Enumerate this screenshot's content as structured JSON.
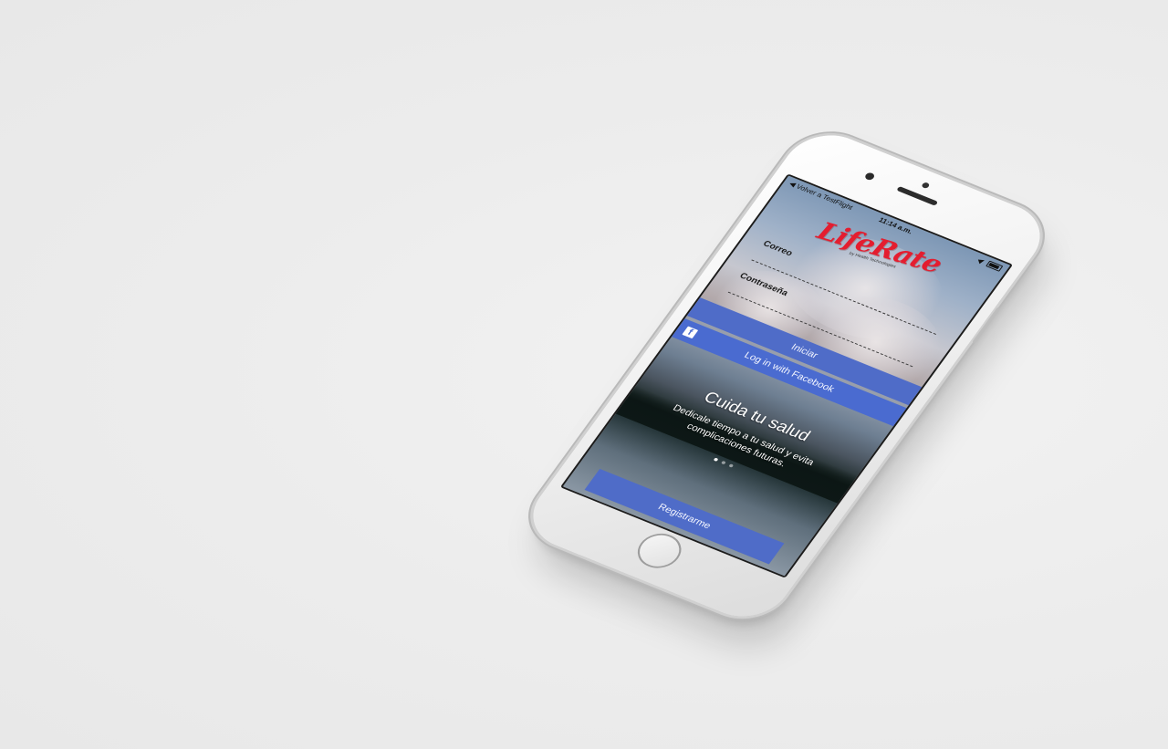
{
  "status_bar": {
    "back_label": "◀ Volver a TestFlight",
    "time": "11:14 a.m.",
    "icons": [
      "location-icon",
      "battery-icon"
    ]
  },
  "logo": {
    "text": "LifeRate",
    "tagline": "by Health Technologies"
  },
  "form": {
    "email_label": "Correo",
    "email_value": "",
    "password_label": "Contraseña",
    "password_value": "",
    "login_button": "Iniciar",
    "facebook_button": "Log in with Facebook",
    "facebook_icon_glyph": "f"
  },
  "carousel": {
    "title": "Cuida tu salud",
    "description": "Dedicale tiempo a tu salud y evita complicaciones futuras.",
    "page_count": 3,
    "active_index": 0
  },
  "register_button": "Registrarme",
  "colors": {
    "background": "#ececec",
    "primary_button": "#4f6cc8",
    "logo_red": "#e41d2f"
  }
}
